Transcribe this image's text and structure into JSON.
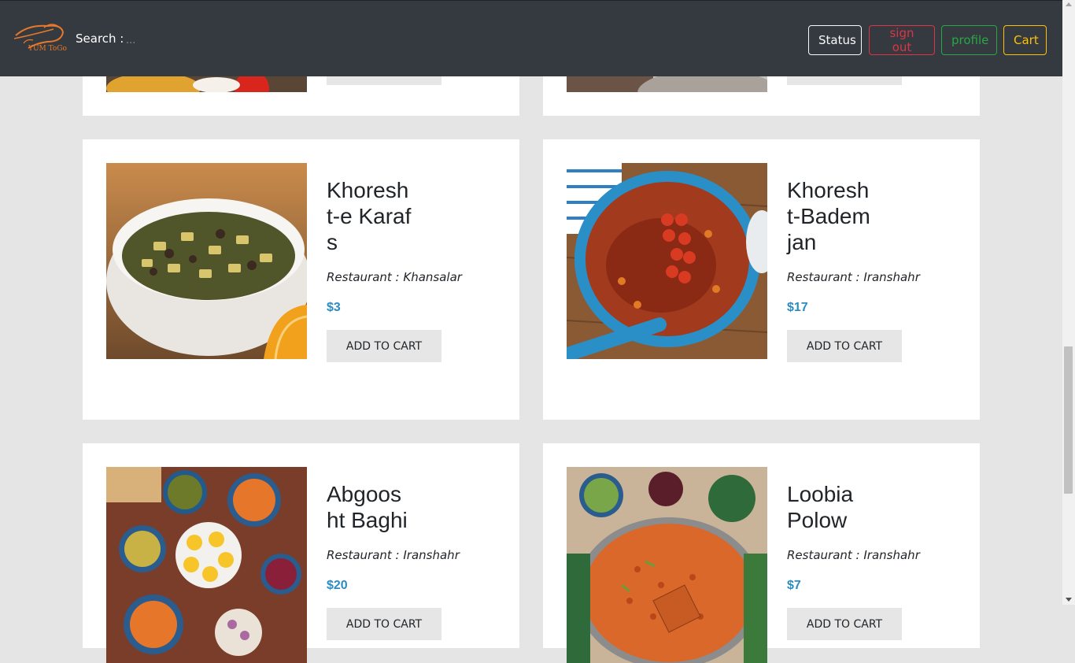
{
  "navbar": {
    "logo_text": "YUM ToGo",
    "search_label": "Search :",
    "search_placeholder": "...",
    "buttons": {
      "status": "Status",
      "sign_out": "sign out",
      "profile": "profile",
      "cart": "Cart"
    }
  },
  "colors": {
    "navbar": "#343a40",
    "status": "#f8f9fa",
    "sign_out": "#dc3545",
    "profile": "#28a745",
    "cart": "#ffc107",
    "price": "#2b8cc4"
  },
  "dishes": [
    {
      "name": "Khoresht-e Karafs",
      "restaurant": "Restaurant : Khansalar",
      "price": "$3",
      "button": "ADD TO CART"
    },
    {
      "name": "Khoresht-Bademjan",
      "restaurant": "Restaurant : Iranshahr",
      "price": "$17",
      "button": "ADD TO CART"
    },
    {
      "name": "Abgoosht Baghi",
      "restaurant": "Restaurant : Iranshahr",
      "price": "$20",
      "button": "ADD TO CART"
    },
    {
      "name": "Loobia Polow",
      "restaurant": "Restaurant : Iranshahr",
      "price": "$7",
      "button": "ADD TO CART"
    }
  ]
}
